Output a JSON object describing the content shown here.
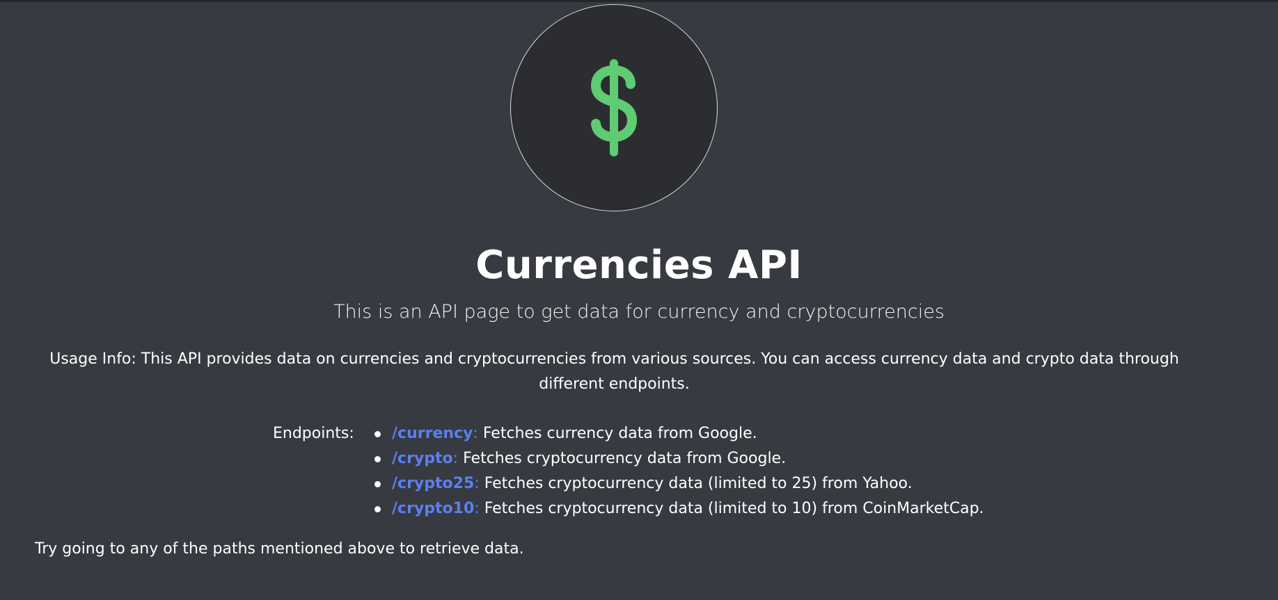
{
  "logo": {
    "icon": "dollar-sign-icon",
    "icon_color": "#5fcb72",
    "circle_color": "#2c2d31",
    "border_color": "#d9d9d9"
  },
  "title": "Currencies API",
  "subtitle": "This is an API page to get data for currency and cryptocurrencies",
  "usage_info": "Usage Info: This API provides data on currencies and cryptocurrencies from various sources. You can access currency data and crypto data through different endpoints.",
  "endpoints_label": "Endpoints:",
  "endpoints": [
    {
      "path": "/currency",
      "description": "Fetches currency data from Google."
    },
    {
      "path": "/crypto",
      "description": "Fetches cryptocurrency data from Google."
    },
    {
      "path": "/crypto25",
      "description": "Fetches cryptocurrency data (limited to 25) from Yahoo."
    },
    {
      "path": "/crypto10",
      "description": "Fetches cryptocurrency data (limited to 10) from CoinMarketCap."
    }
  ],
  "footer_note": "Try going to any of the paths mentioned above to retrieve data.",
  "colors": {
    "background": "#373a40",
    "link": "#5b7ff0",
    "text": "#ffffff"
  }
}
